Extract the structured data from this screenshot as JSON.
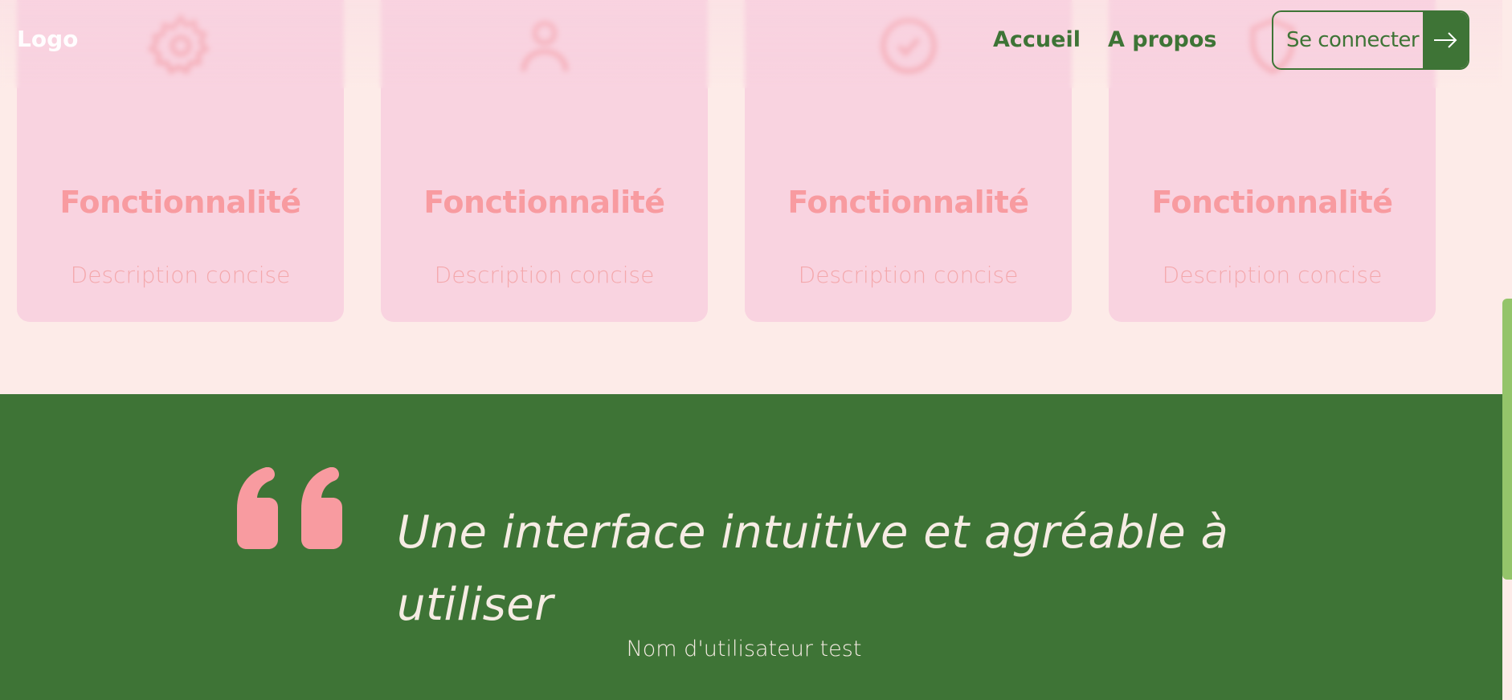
{
  "nav": {
    "logo": "Logo",
    "links": [
      "Accueil",
      "A propos"
    ],
    "login_label": "Se connecter",
    "login_icon": "arrow-right-icon"
  },
  "features": [
    {
      "icon": "gear-icon",
      "title": "Fonctionnalité",
      "description": "Description concise"
    },
    {
      "icon": "user-icon",
      "title": "Fonctionnalité",
      "description": "Description concise"
    },
    {
      "icon": "check-circle-icon",
      "title": "Fonctionnalité",
      "description": "Description concise"
    },
    {
      "icon": "shield-icon",
      "title": "Fonctionnalité",
      "description": "Description concise"
    }
  ],
  "testimonial": {
    "quote": "Une interface intuitive et agréable à utiliser",
    "author": "Nom d'utilisateur test"
  },
  "colors": {
    "background": "#fdebe8",
    "card": "#f9d3e0",
    "accent_pink": "#f89ba0",
    "green": "#3e7436",
    "cream": "#f6ece4",
    "scroll_thumb": "#94c46a"
  }
}
